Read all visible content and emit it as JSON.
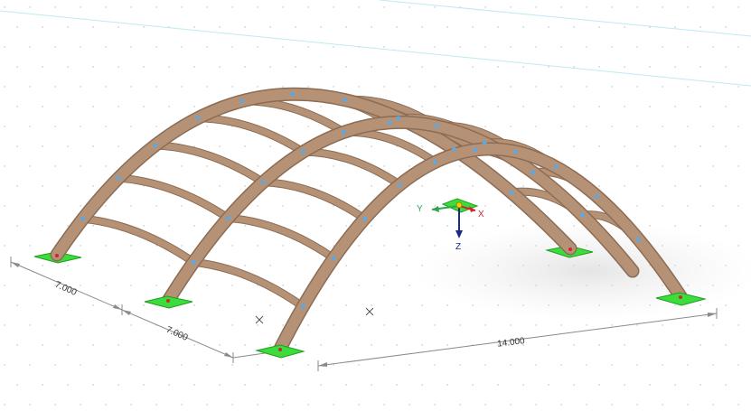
{
  "view": {
    "background": "#ffffff",
    "grid_color": "#b8bcc0",
    "timber_color": "#b59275",
    "timber_edge": "#8c6c55",
    "support_color": "#3ddc3d",
    "node_color": "#5aa9e6",
    "dimension_color": "#888888"
  },
  "dimensions": {
    "left_bay_1": "7.000",
    "left_bay_2": "7.000",
    "span": "14.000"
  },
  "coordinate_system": {
    "x_label": "X",
    "y_label": "Y",
    "z_label": "Z",
    "x_color": "#d0272b",
    "y_color": "#2da44e",
    "z_color": "#1a2a8a"
  },
  "markers": [
    "x-cross-marker",
    "x-cross-marker"
  ]
}
